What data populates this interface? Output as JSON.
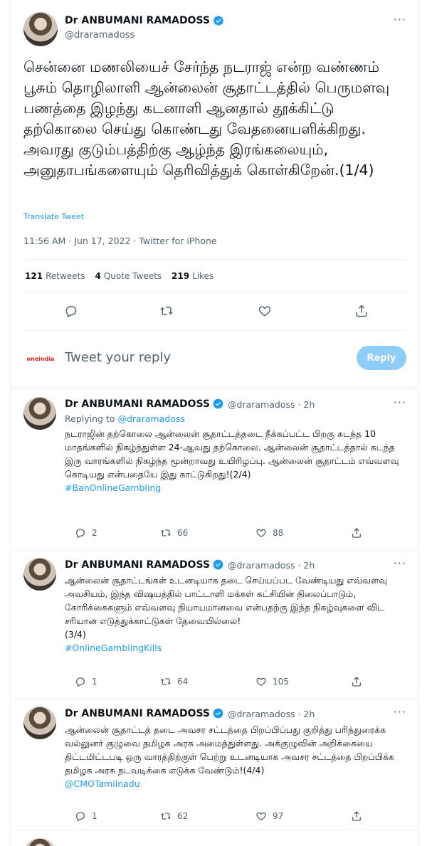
{
  "main_tweet": {
    "author_name": "Dr ANBUMANI RAMADOSS",
    "handle": "@draramadoss",
    "text": "சென்னை மணலியைச் சேர்ந்த நடராஜ் என்ற வண்ணம் பூசும் தொழிலாளி ஆன்லைன் சூதாட்டத்தில் பெருமளவு பணத்தை இழந்து கடனாளி ஆனதால் தூக்கிட்டு தற்கொலை செய்து கொண்டது வேதனையளிக்கிறது. அவரது குடும்பத்திற்கு ஆழ்ந்த இரங்கலையும், அனுதாபங்களையும் தெரிவித்துக் கொள்கிறேன்.(1/4)",
    "translate_label": "Translate Tweet",
    "timestamp": "11:56 AM · Jun 17, 2022 · Twitter for iPhone",
    "retweets_count": "121",
    "retweets_label": "Retweets",
    "quote_count": "4",
    "quote_label": "Quote Tweets",
    "likes_count": "219",
    "likes_label": "Likes"
  },
  "reply_composer": {
    "avatar_text": "oneindia",
    "placeholder": "Tweet your reply",
    "button_label": "Reply"
  },
  "thread": [
    {
      "author_name": "Dr ANBUMANI RAMADOSS",
      "handle_time": "@draramadoss · 2h",
      "replying_prefix": "Replying to ",
      "replying_handle": "@draramadoss",
      "text": "நடராஜின் தற்கொலை ஆன்லைன் சூதாட்டத்தடை நீக்கப்பட்ட பிறகு கடந்த 10 மாதங்களில் நிகழ்ந்துள்ள 24-ஆவது தற்கொலை. ஆன்லைன் சூதாட்டத்தால் கடந்த இரு வாரங்களில் நிகழ்ந்த மூன்றாவது உயிரிழப்பு. ஆன்லைன் சூதாட்டம் எவ்வளவு கொடியது என்பதையே இது காட்டுகிறது!(2/4)",
      "tag": "#BanOnlineGambling",
      "replies": "2",
      "retweets": "66",
      "likes": "88"
    },
    {
      "author_name": "Dr ANBUMANI RAMADOSS",
      "handle_time": "@draramadoss · 2h",
      "text": "ஆன்லைன் சூதாட்டங்கள் உடனடியாக தடை செய்யப்பட வேண்டியது எவ்வளவு அவசியம், இந்த விஷயத்தில் பாட்டாளி மக்கள் கட்சியின் நிலைப்பாடும், கோரிக்கைகளும் எவ்வளவு நியாயமானவை என்பதற்கு இந்த நிகழ்வுகளை விட சரியான எடுத்துக்காட்டுகள் தேவையில்லை!",
      "text_suffix": "(3/4)",
      "tag": "#OnlineGamblingKills",
      "replies": "1",
      "retweets": "64",
      "likes": "105"
    },
    {
      "author_name": "Dr ANBUMANI RAMADOSS",
      "handle_time": "@draramadoss · 2h",
      "text": "ஆன்லைன் சூதாட்டத் தடை அவசர சட்டத்தை பிறப்பிப்பது குறித்து பரிந்துரைக்க வல்லுனர் குழுவை தமிழக அரசு அமைத்துள்ளது. அக்குழுவின் அறிக்கையை திட்டமிட்டபடி ஒரு வாரத்திற்குள் பெற்று உடனடியாக அவசர சட்டத்தை பிறப்பிக்க தமிழக அரசு நடவடிக்கை எடுக்க வேண்டும்!(4/4)",
      "tag": "@CMOTamilnadu",
      "replies": "1",
      "retweets": "62",
      "likes": "97"
    }
  ],
  "colors": {
    "accent": "#1d9bf0",
    "text": "#0f1419",
    "secondary": "#536471",
    "reply_button": "#8ecdf7",
    "divider": "#eff3f4"
  },
  "icons": [
    "more-icon",
    "verified-icon",
    "reply-icon",
    "retweet-icon",
    "like-icon",
    "share-icon"
  ]
}
